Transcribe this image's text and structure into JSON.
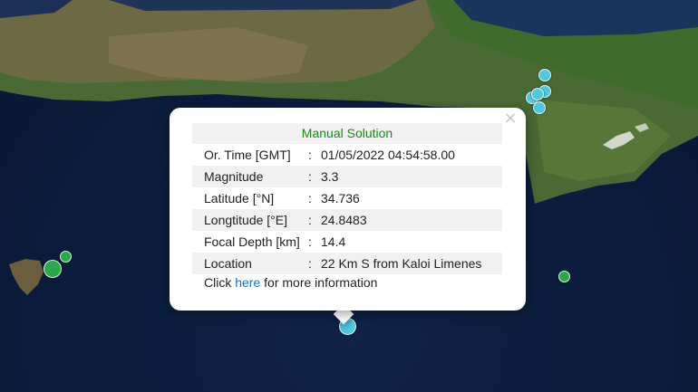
{
  "popup": {
    "title": "Manual Solution",
    "close_glyph": "×",
    "rows": [
      {
        "label": "Or. Time [GMT]",
        "sep": ":",
        "value": "01/05/2022 04:54:58.00"
      },
      {
        "label": "Magnitude",
        "sep": ":",
        "value": "3.3"
      },
      {
        "label": "Latitude [°N]",
        "sep": ":",
        "value": "34.736"
      },
      {
        "label": "Longtitude [°E]",
        "sep": ":",
        "value": "24.8483"
      },
      {
        "label": "Focal Depth [km]",
        "sep": ":",
        "value": "14.4"
      },
      {
        "label": "Location",
        "sep": ":",
        "value": "22 Km S from Kaloi Limenes"
      }
    ],
    "more": {
      "prefix": "Click ",
      "link": "here",
      "suffix": " for more information"
    }
  },
  "colors": {
    "sea": "#0b1c3b",
    "marker_cyan": "#4fc8dc",
    "marker_green": "#2aa84a",
    "popup_title": "#1a8a1a",
    "link": "#1a73c8"
  }
}
